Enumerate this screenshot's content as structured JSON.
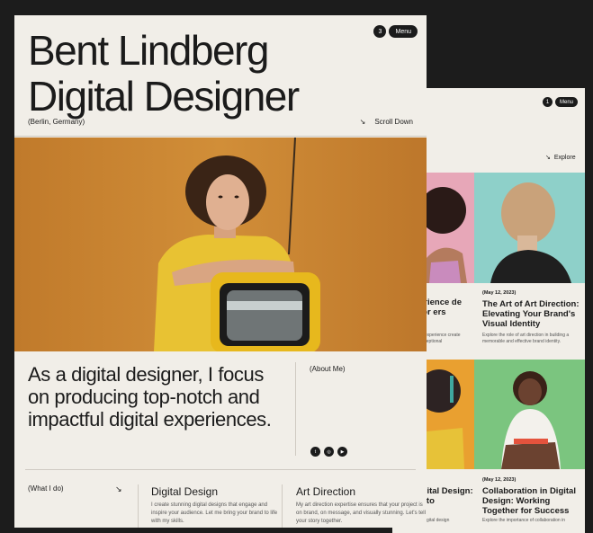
{
  "back_panel": {
    "menu_count": "1",
    "menu_label": "Menu",
    "explore_label": "Explore",
    "cards": [
      {
        "date": "",
        "title": "erience de for ers",
        "text": "ur experience create exceptional"
      },
      {
        "date": "(May 12, 2023)",
        "title": "The Art of Art Direction: Elevating Your Brand's Visual Identity",
        "text": "Explore the role of art direction in building a memorable and effective brand identity."
      },
      {
        "date": "",
        "title": "igital Design: s to",
        "text": "d digital design"
      },
      {
        "date": "(May 12, 2023)",
        "title": "Collaboration in Digital Design: Working Together for Success",
        "text": "Explore the importance of collaboration in"
      }
    ]
  },
  "front_panel": {
    "title_line1": "Bent Lindberg",
    "title_line2": "Digital Designer",
    "menu_count": "3",
    "menu_label": "Menu",
    "location": "(Berlin, Germany)",
    "scroll_label": "Scroll Down",
    "statement": "As a digital designer, I focus on producing top-notch and impactful digital experiences.",
    "about_label": "(About Me)",
    "socials": [
      "twitter-icon",
      "instagram-icon",
      "youtube-icon"
    ],
    "what_i_do_label": "(What I do)",
    "services": [
      {
        "title": "Digital Design",
        "text": "I create stunning digital designs that engage and inspire your audience. Let me bring your brand to life with my skills."
      },
      {
        "title": "Art Direction",
        "text": "My art direction expertise ensures that your project is on brand, on message, and visually stunning. Let's tell your story together."
      }
    ]
  },
  "colors": {
    "background": "#1c1c1c",
    "panel": "#f1eee8",
    "photo": "#cb8733",
    "ink": "#1b1b1b"
  }
}
